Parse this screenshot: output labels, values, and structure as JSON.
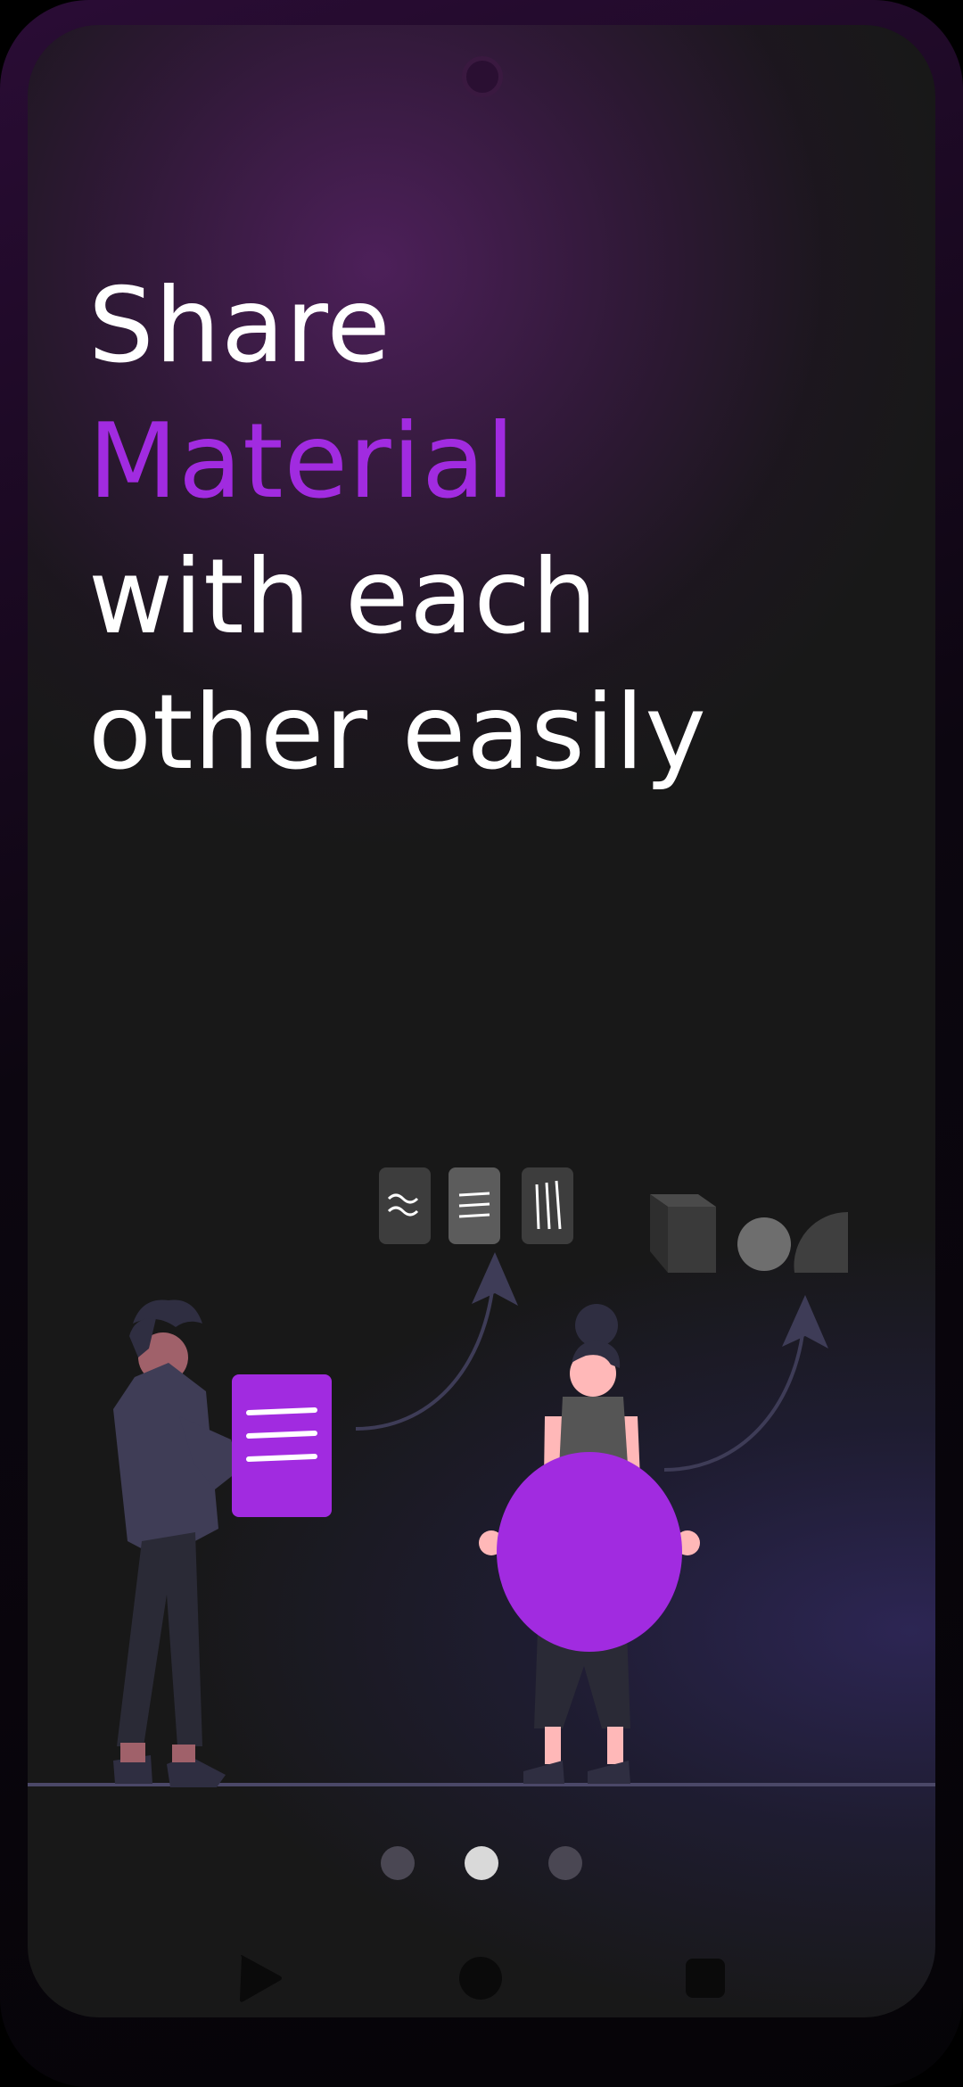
{
  "headline": {
    "line1": "Share",
    "line2": "Material",
    "line3": "with each",
    "line4": "other easily"
  },
  "colors": {
    "accent": "#a12be0",
    "text": "#ffffff",
    "background": "#181818",
    "dot_inactive": "#4a4753",
    "dot_active": "#d9d9d9"
  },
  "pager": {
    "page_count": 3,
    "active_index": 1
  },
  "navbar": {
    "back_icon": "play-triangle-icon",
    "home_icon": "circle-icon",
    "recent_icon": "square-icon"
  }
}
